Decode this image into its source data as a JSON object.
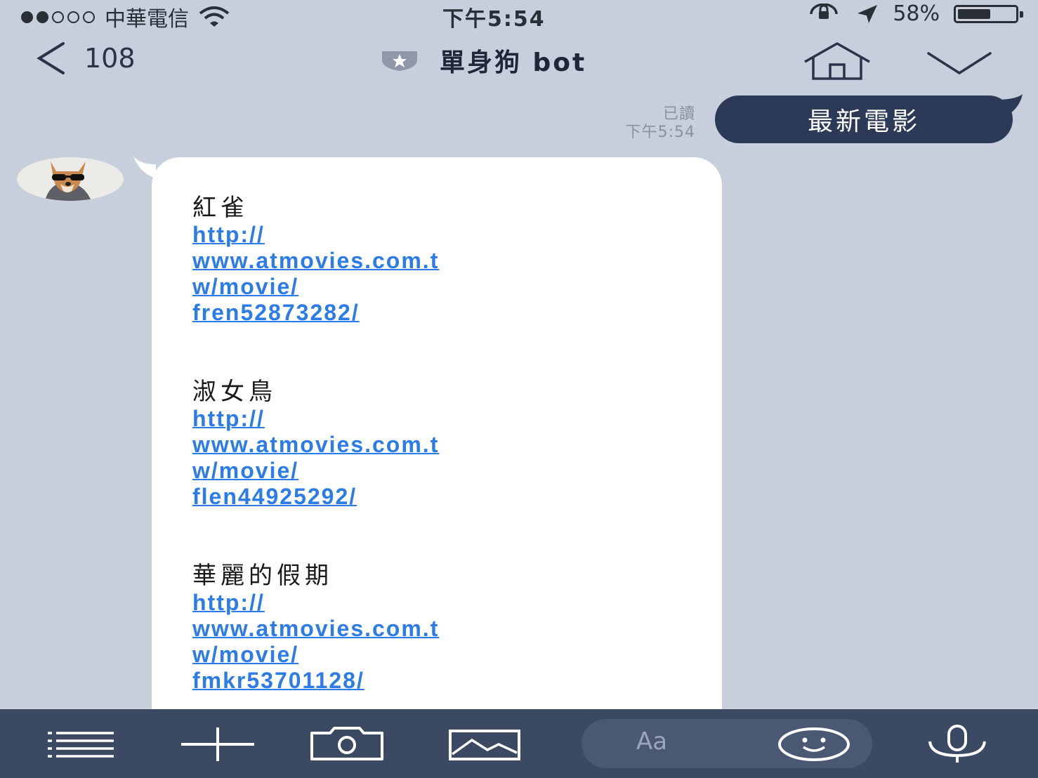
{
  "status_bar": {
    "carrier": "中華電信",
    "time": "下午5:54",
    "battery_percent": "58%",
    "battery_level": 0.58
  },
  "header": {
    "back_count": "108",
    "title": "單身狗 bot"
  },
  "messages": {
    "outgoing": {
      "text": "最新電影",
      "read_label": "已讀",
      "time": "下午5:54"
    },
    "incoming": {
      "movies": [
        {
          "title": "紅雀",
          "link": "http://\nwww.atmovies.com.t\nw/movie/\nfren52873282/"
        },
        {
          "title": "淑女鳥",
          "link": "http://\nwww.atmovies.com.t\nw/movie/\nflen44925292/"
        },
        {
          "title": "華麗的假期",
          "link": "http://\nwww.atmovies.com.t\nw/movie/\nfmkr53701128/"
        }
      ]
    }
  },
  "input": {
    "placeholder": "Aa"
  },
  "colors": {
    "background": "#c7cfdc",
    "outgoing_bubble": "#2c3a58",
    "toolbar": "#3b4963",
    "link": "#2b7be8"
  },
  "icons": {
    "menu": "menu-icon",
    "plus": "plus-icon",
    "camera": "camera-icon",
    "image": "image-icon",
    "emoji": "emoji-icon",
    "mic": "microphone-icon",
    "home": "home-icon",
    "chevron": "chevron-down-icon",
    "back": "back-arrow-icon",
    "verified": "official-badge-icon"
  }
}
